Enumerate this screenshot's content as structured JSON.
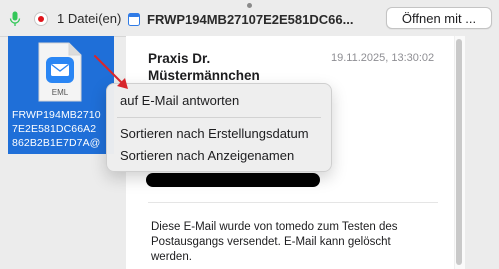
{
  "toolbar": {
    "file_count": "1 Datei(en)",
    "window_title": "FRWP194MB27107E2E581DC66...",
    "open_with_label": "Öffnen mit ..."
  },
  "file": {
    "badge": "EML",
    "name_lines": [
      "FRWP194MB2710",
      "7E2E581DC66A2",
      "862B2B1E7D7A@"
    ]
  },
  "email": {
    "sender_lines": [
      "Praxis Dr.",
      "Müstermännchen"
    ],
    "date": "19.11.2025, 13:30:02",
    "body_lines": [
      "Diese E-Mail wurde von tomedo zum Testen des",
      "Postausgangs versendet. E-Mail kann gelöscht",
      "werden."
    ]
  },
  "context_menu": {
    "items": [
      "auf E-Mail antworten",
      "Sortieren nach Erstellungsdatum",
      "Sortieren nach Anzeigenamen"
    ]
  },
  "icons": {
    "microphone": "microphone-icon",
    "record": "record-icon",
    "document": "document-icon",
    "mail_file": "eml-file-icon",
    "arrow": "red-arrow-annotation"
  },
  "colors": {
    "selection": "#1f6fd8",
    "record_red": "#e0141b",
    "mic_green": "#34c759",
    "arrow_red": "#d8262b"
  }
}
